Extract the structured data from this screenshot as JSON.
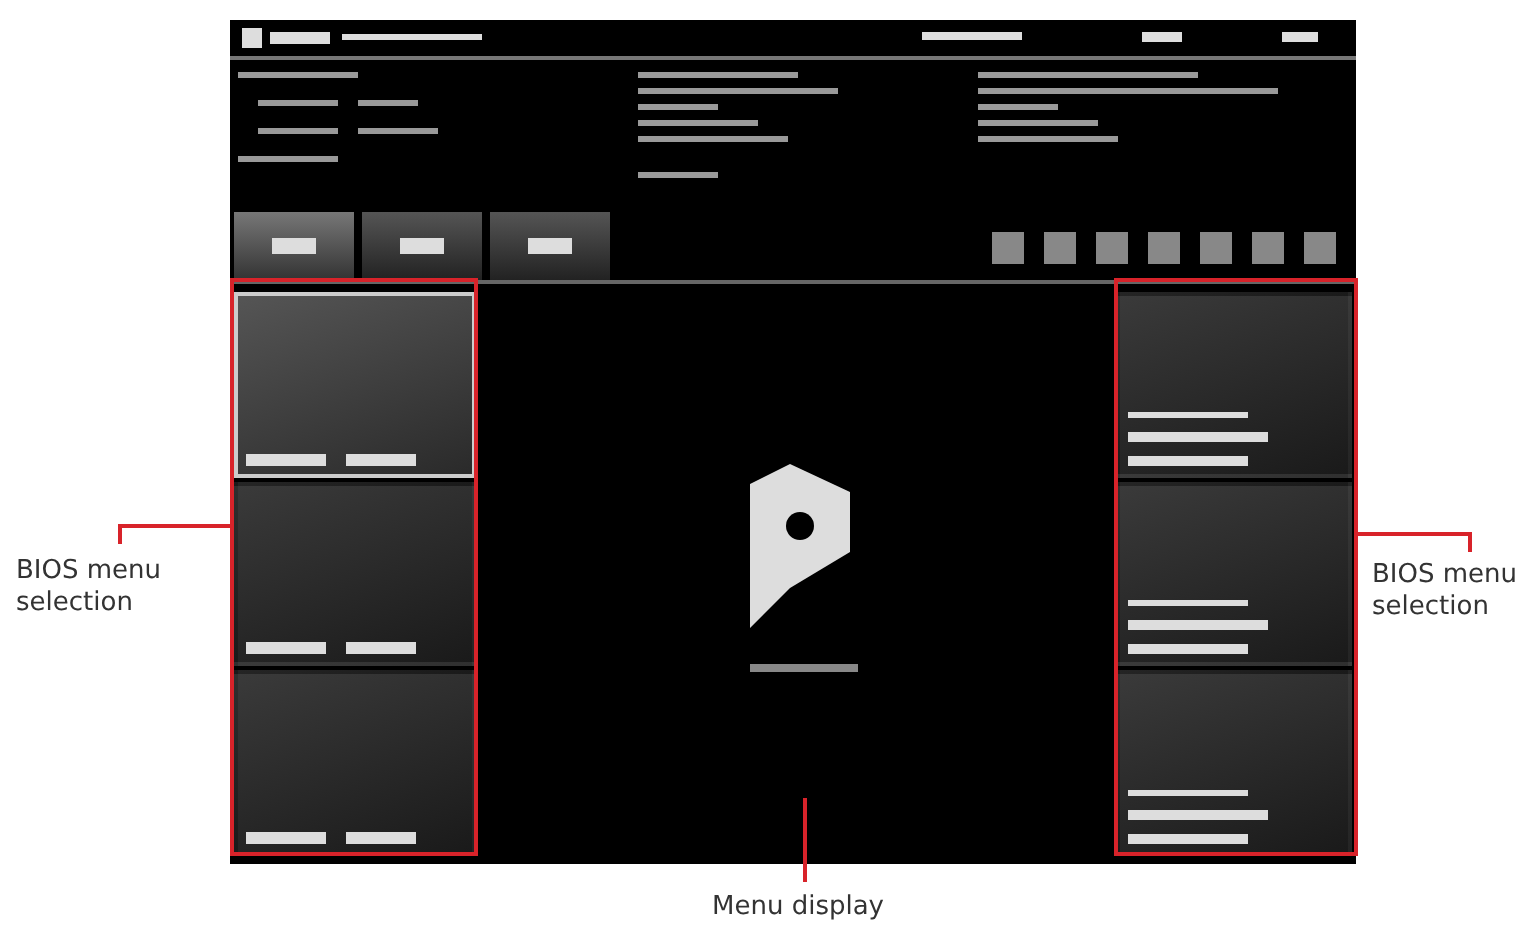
{
  "left_menu": [
    {
      "selected": true
    },
    {
      "selected": false
    },
    {
      "selected": false
    }
  ],
  "callouts": [
    {
      "label": "BIOS menu selection",
      "kind": "left"
    },
    {
      "label": "BIOS menu selection",
      "kind": "right"
    },
    {
      "label": "Menu display",
      "kind": "bottom"
    }
  ]
}
